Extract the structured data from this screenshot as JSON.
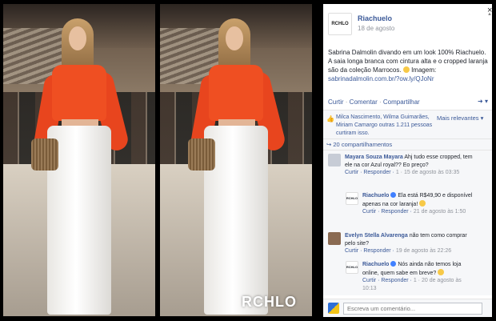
{
  "photos": {
    "watermark": "RCHLO"
  },
  "post": {
    "page_name": "Riachuelo",
    "avatar_label": "RCHLO",
    "date": "18 de agosto",
    "text_before_link": "Sabrina Dalmolin divando em um look 100% Riachuelo. A saia longa branca com cintura alta e o cropped laranja são da coleção Marrocos.",
    "text_image_label": "Imagem:",
    "link": "sabrinadalmolin.com.br/?ow.ly/QJoNr",
    "close_label": "×"
  },
  "actions": {
    "like": "Curtir",
    "comment": "Comentar",
    "share": "Compartilhar",
    "separator": " · "
  },
  "likes": {
    "names": "Milca Nascimento, Wilma Guimarães, Miriam Camargo",
    "others": "outras 1.211 pessoas curtiram isso.",
    "more_relevant": "Mais relevantes ▾"
  },
  "shares": {
    "label": "20 compartilhamentos"
  },
  "comments": [
    {
      "author": "Mayara Souza Mayara",
      "text": "Ahj tudo esse cropped, tem ele na cor Azul royal?? Eo preço?",
      "like": "Curtir",
      "reply": "Responder",
      "meta": "1 · 15 de agosto às 03:35"
    },
    {
      "author": "Riachuelo",
      "text": "Ela está R$49,90 e disponível apenas na cor laranja!",
      "like": "Curtir",
      "reply": "Responder",
      "meta": "21 de agosto às 1:50"
    },
    {
      "author": "Evelyn Stella Alvarenga",
      "text": "não tem como comprar pelo site?",
      "like": "Curtir",
      "reply": "Responder",
      "meta": "19 de agosto às 22:26"
    },
    {
      "author": "Riachuelo",
      "text": "Nós ainda não temos loja online, quem sabe em breve?",
      "like": "Curtir",
      "reply": "Responder",
      "meta": "1 · 20 de agosto às 10:13"
    }
  ],
  "compose": {
    "placeholder": "Escreva um comentário..."
  },
  "colors": {
    "link": "#3b5998",
    "top_orange": "#ef4f22",
    "skirt_white": "#ffffff"
  }
}
